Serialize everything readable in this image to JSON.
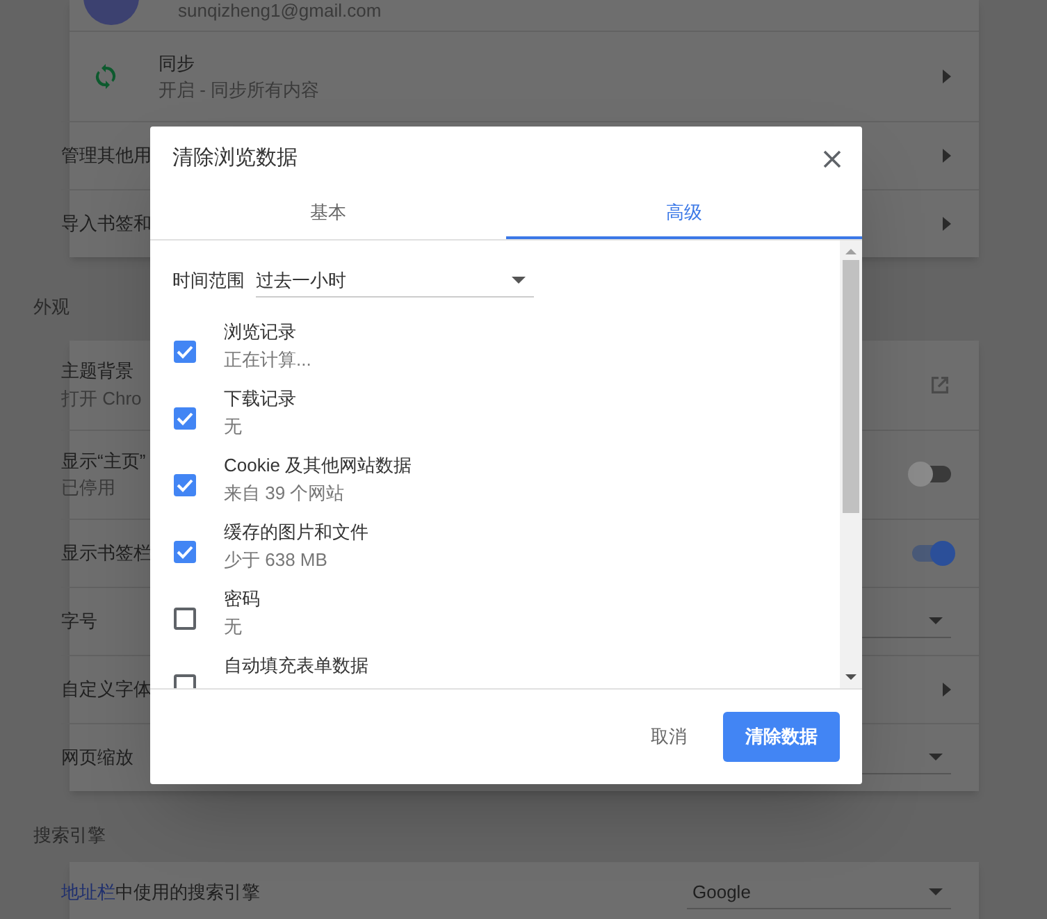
{
  "settings": {
    "account": {
      "email": "sunqizheng1@gmail.com"
    },
    "people_rows": [
      {
        "kind": "sync",
        "title": "同步",
        "subtitle": "开启 - 同步所有内容"
      },
      {
        "kind": "link",
        "title": "管理其他用"
      },
      {
        "kind": "link",
        "title": "导入书签和"
      }
    ],
    "appearance": {
      "heading": "外观",
      "rows": [
        {
          "kind": "external",
          "title": "主题背景",
          "subtitle": "打开 Chro"
        },
        {
          "kind": "toggle",
          "title": "显示“主页”",
          "subtitle": "已停用",
          "on": false
        },
        {
          "kind": "toggle",
          "title": "显示书签栏",
          "on": true
        },
        {
          "kind": "dropdown",
          "title": "字号"
        },
        {
          "kind": "link",
          "title": "自定义字体"
        },
        {
          "kind": "dropdown",
          "title": "网页缩放"
        }
      ]
    },
    "search_engine": {
      "heading": "搜索引擎",
      "link": "地址栏",
      "text": "中使用的搜索引擎",
      "value": "Google"
    }
  },
  "dialog": {
    "title": "清除浏览数据",
    "tabs": [
      {
        "label": "基本",
        "selected": false
      },
      {
        "label": "高级",
        "selected": true
      }
    ],
    "time_range": {
      "label": "时间范围",
      "value": "过去一小时"
    },
    "items": [
      {
        "label": "浏览记录",
        "detail": "正在计算...",
        "checked": true
      },
      {
        "label": "下载记录",
        "detail": "无",
        "checked": true
      },
      {
        "label": "Cookie 及其他网站数据",
        "detail": "来自 39 个网站",
        "checked": true
      },
      {
        "label": "缓存的图片和文件",
        "detail": "少于 638 MB",
        "checked": true
      },
      {
        "label": "密码",
        "detail": "无",
        "checked": false
      },
      {
        "label": "自动填充表单数据",
        "checked": false
      }
    ],
    "buttons": {
      "cancel": "取消",
      "confirm": "清除数据"
    }
  }
}
